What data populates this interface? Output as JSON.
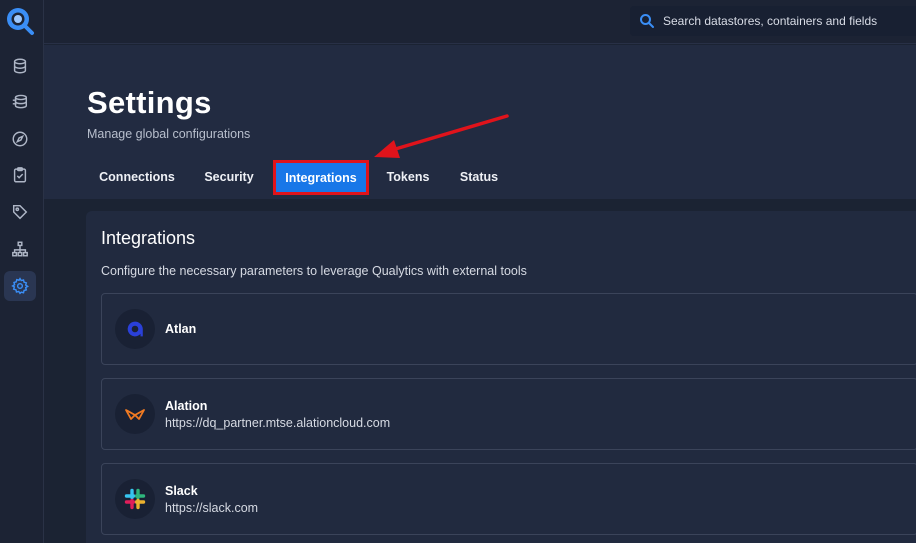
{
  "search": {
    "placeholder": "Search datastores, containers and fields"
  },
  "header": {
    "title": "Settings",
    "subtitle": "Manage global configurations"
  },
  "tabs": [
    {
      "label": "Connections"
    },
    {
      "label": "Security"
    },
    {
      "label": "Integrations",
      "active": true
    },
    {
      "label": "Tokens"
    },
    {
      "label": "Status"
    }
  ],
  "sidebar": {
    "items": [
      {
        "icon": "database-icon"
      },
      {
        "icon": "database-stack-icon"
      },
      {
        "icon": "compass-icon"
      },
      {
        "icon": "clipboard-check-icon"
      },
      {
        "icon": "tag-icon"
      },
      {
        "icon": "org-chart-icon"
      },
      {
        "icon": "gear-icon",
        "active": true
      }
    ]
  },
  "panel": {
    "title": "Integrations",
    "description": "Configure the necessary parameters to leverage Qualytics with external tools",
    "integrations": [
      {
        "name": "Atlan",
        "url": ""
      },
      {
        "name": "Alation",
        "url": "https://dq_partner.mtse.alationcloud.com"
      },
      {
        "name": "Slack",
        "url": "https://slack.com"
      }
    ]
  },
  "colors": {
    "accent": "#1877e8",
    "highlight_border": "#e0131b",
    "background": "#1b2333"
  }
}
